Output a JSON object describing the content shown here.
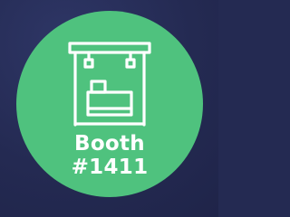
{
  "badge": {
    "label": "Booth",
    "number": "#1411",
    "icon": "booth-icon",
    "colors": {
      "background": "#242a52",
      "badge": "#4fc27e",
      "foreground": "#ffffff"
    }
  }
}
